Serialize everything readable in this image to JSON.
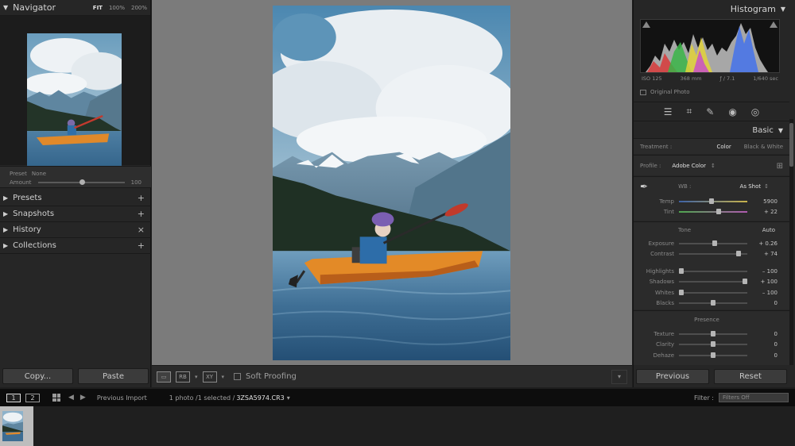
{
  "navigator": {
    "title": "Navigator",
    "zoom_options": [
      "FIT",
      "100%",
      "200%"
    ],
    "zoom_selected": "FIT",
    "zoom_dropdown": "↕"
  },
  "preset": {
    "label": "Preset",
    "value": "None",
    "amount_label": "Amount",
    "amount_value": "100",
    "amount_level": 0.5
  },
  "left_panels": [
    {
      "label": "Presets",
      "action": "+"
    },
    {
      "label": "Snapshots",
      "action": "+"
    },
    {
      "label": "History",
      "action": "×"
    },
    {
      "label": "Collections",
      "action": "+"
    }
  ],
  "left_buttons": {
    "copy": "Copy...",
    "paste": "Paste"
  },
  "toolbar": {
    "soft_proofing": "Soft Proofing",
    "view_loupe_icon": "loupe-view-icon",
    "compare_xy": "XY",
    "compare_rb": "RB",
    "menu_icon": "chevron-down-icon"
  },
  "histogram": {
    "title": "Histogram",
    "iso": "ISO 125",
    "focal": "368 mm",
    "aperture": "ƒ / 7.1",
    "shutter": "1/640 sec",
    "original_photo": "Original Photo"
  },
  "tools": [
    "sliders-icon",
    "crop-icon",
    "healing-icon",
    "redeye-icon",
    "masking-icon"
  ],
  "basic": {
    "title": "Basic",
    "treatment_label": "Treatment :",
    "treatment_color": "Color",
    "treatment_bw": "Black & White",
    "profile_label": "Profile :",
    "profile_value": "Adobe Color",
    "wb_label": "WB :",
    "wb_value": "As Shot",
    "temp": {
      "label": "Temp",
      "value": "5900",
      "level": 0.48
    },
    "tint": {
      "label": "Tint",
      "value": "+ 22",
      "level": 0.58
    },
    "tone_label": "Tone",
    "auto_label": "Auto",
    "tone": [
      {
        "label": "Exposure",
        "value": "+ 0.26",
        "level": 0.52
      },
      {
        "label": "Contrast",
        "value": "+ 74",
        "level": 0.87
      }
    ],
    "tone2": [
      {
        "label": "Highlights",
        "value": "– 100",
        "level": 0.03
      },
      {
        "label": "Shadows",
        "value": "+ 100",
        "level": 0.97
      },
      {
        "label": "Whites",
        "value": "– 100",
        "level": 0.03
      },
      {
        "label": "Blacks",
        "value": "0",
        "level": 0.5
      }
    ],
    "presence_label": "Presence",
    "presence": [
      {
        "label": "Texture",
        "value": "0",
        "level": 0.5
      },
      {
        "label": "Clarity",
        "value": "0",
        "level": 0.5
      },
      {
        "label": "Dehaze",
        "value": "0",
        "level": 0.5
      }
    ]
  },
  "right_buttons": {
    "previous": "Previous",
    "reset": "Reset"
  },
  "filmstrip_bar": {
    "page1": "1",
    "page2": "2",
    "source": "Previous Import",
    "count": "1 photo /1 selected /",
    "filename": "3ZSA5974.CR3",
    "filter_label": "Filter :",
    "filter_value": "Filters Off"
  },
  "colors": {
    "panel": "#262626",
    "center": "#7b7b7b",
    "accent": "#dcdcdc"
  }
}
